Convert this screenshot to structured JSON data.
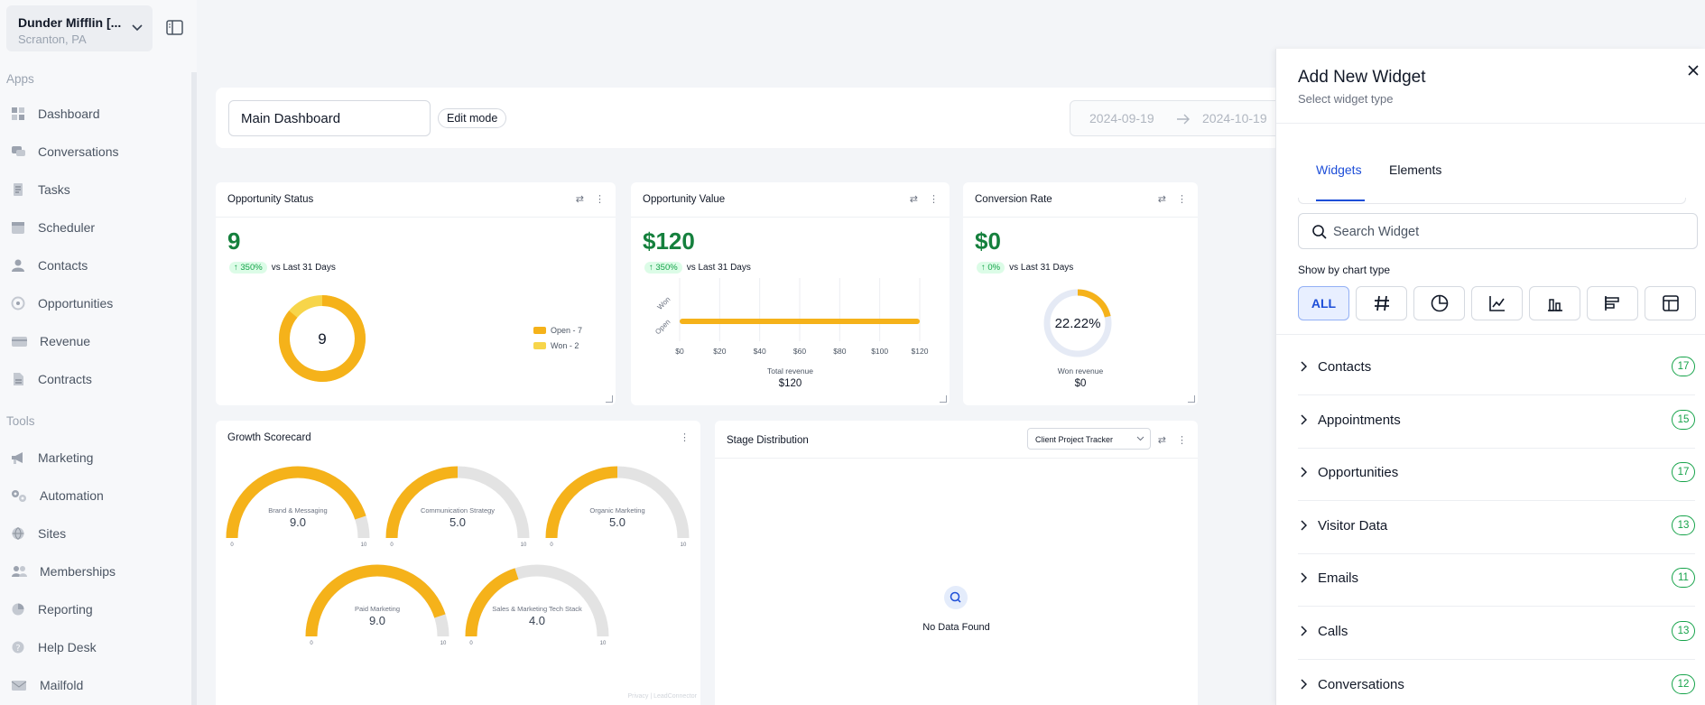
{
  "location": {
    "name": "Dunder Mifflin [...",
    "city": "Scranton, PA"
  },
  "sidebar": {
    "apps_title": "Apps",
    "tools_title": "Tools",
    "apps": [
      {
        "label": "Dashboard",
        "icon": "dashboard-icon"
      },
      {
        "label": "Conversations",
        "icon": "chat-icon"
      },
      {
        "label": "Tasks",
        "icon": "tasks-icon"
      },
      {
        "label": "Scheduler",
        "icon": "calendar-icon"
      },
      {
        "label": "Contacts",
        "icon": "person-icon"
      },
      {
        "label": "Opportunities",
        "icon": "target-icon"
      },
      {
        "label": "Revenue",
        "icon": "card-icon"
      },
      {
        "label": "Contracts",
        "icon": "document-icon"
      }
    ],
    "tools": [
      {
        "label": "Marketing",
        "icon": "megaphone-icon"
      },
      {
        "label": "Automation",
        "icon": "gears-icon"
      },
      {
        "label": "Sites",
        "icon": "globe-icon"
      },
      {
        "label": "Memberships",
        "icon": "people-icon"
      },
      {
        "label": "Reporting",
        "icon": "pie-icon"
      },
      {
        "label": "Help Desk",
        "icon": "help-icon"
      },
      {
        "label": "Mailfold",
        "icon": "mail-icon"
      }
    ]
  },
  "header": {
    "dashboard_name": "Main Dashboard",
    "edit_mode": "Edit mode",
    "date_start": "2024-09-19",
    "date_end": "2024-10-19"
  },
  "widgets": {
    "opportunity_status": {
      "title": "Opportunity Status",
      "value": "9",
      "pct": "350%",
      "vs": "vs Last 31 Days",
      "center": "9",
      "legend": [
        {
          "label": "Open - 7",
          "color": "#f5b21a"
        },
        {
          "label": "Won - 2",
          "color": "#f7d54a"
        }
      ]
    },
    "opportunity_value": {
      "title": "Opportunity Value",
      "value": "$120",
      "pct": "350%",
      "vs": "vs Last 31 Days",
      "rows": [
        "Won",
        "Open"
      ],
      "ticks": [
        "$0",
        "$20",
        "$40",
        "$60",
        "$80",
        "$100",
        "$120"
      ],
      "total_label": "Total revenue",
      "total_value": "$120"
    },
    "conversion_rate": {
      "title": "Conversion Rate",
      "value": "$0",
      "pct": "0%",
      "vs": "vs Last 31 Days",
      "gauge": "22.22%",
      "sub_label": "Won revenue",
      "sub_value": "$0"
    },
    "growth_scorecard": {
      "title": "Growth Scorecard",
      "gauges": [
        {
          "label": "Brand & Messaging",
          "value": "9.0",
          "min": "0",
          "max": "10"
        },
        {
          "label": "Communication Strategy",
          "value": "5.0",
          "min": "0",
          "max": "10"
        },
        {
          "label": "Organic Marketing",
          "value": "5.0",
          "min": "0",
          "max": "10"
        },
        {
          "label": "Paid Marketing",
          "value": "9.0",
          "min": "0",
          "max": "10"
        },
        {
          "label": "Sales & Marketing Tech Stack",
          "value": "4.0",
          "min": "0",
          "max": "10"
        }
      ],
      "footer": "Privacy | LeadConnector"
    },
    "stage_distribution": {
      "title": "Stage Distribution",
      "select": "Client Project Tracker",
      "empty": "No Data Found"
    }
  },
  "chart_data": [
    {
      "type": "pie",
      "title": "Opportunity Status",
      "categories": [
        "Open",
        "Won"
      ],
      "values": [
        7,
        2
      ]
    },
    {
      "type": "bar",
      "title": "Opportunity Value",
      "categories": [
        "Won",
        "Open"
      ],
      "values": [
        0,
        120
      ],
      "xlim": [
        0,
        120
      ]
    },
    {
      "type": "bar",
      "title": "Growth Scorecard",
      "categories": [
        "Brand & Messaging",
        "Communication Strategy",
        "Organic Marketing",
        "Paid Marketing",
        "Sales & Marketing Tech Stack"
      ],
      "values": [
        9.0,
        5.0,
        5.0,
        9.0,
        4.0
      ],
      "ylim": [
        0,
        10
      ]
    }
  ],
  "panel": {
    "title": "Add New Widget",
    "subtitle": "Select widget type",
    "tabs": [
      "Widgets",
      "Elements"
    ],
    "search_placeholder": "Search Widget",
    "show_by": "Show by chart type",
    "all_label": "ALL",
    "categories": [
      {
        "label": "Contacts",
        "count": "17"
      },
      {
        "label": "Appointments",
        "count": "15"
      },
      {
        "label": "Opportunities",
        "count": "17"
      },
      {
        "label": "Visitor Data",
        "count": "13"
      },
      {
        "label": "Emails",
        "count": "11"
      },
      {
        "label": "Calls",
        "count": "13"
      },
      {
        "label": "Conversations",
        "count": "12"
      }
    ]
  }
}
